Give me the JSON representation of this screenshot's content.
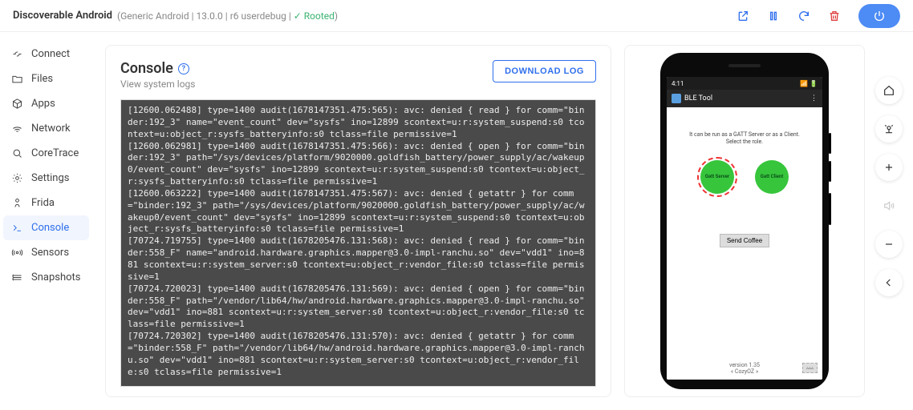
{
  "header": {
    "device_name": "Discoverable Android",
    "meta_os": "Generic Android",
    "meta_ver": "13.0.0",
    "meta_build": "r6 userdebug",
    "rooted_label": "Rooted"
  },
  "sidebar": {
    "items": [
      {
        "label": "Connect"
      },
      {
        "label": "Files"
      },
      {
        "label": "Apps"
      },
      {
        "label": "Network"
      },
      {
        "label": "CoreTrace"
      },
      {
        "label": "Settings"
      },
      {
        "label": "Frida"
      },
      {
        "label": "Console"
      },
      {
        "label": "Sensors"
      },
      {
        "label": "Snapshots"
      }
    ]
  },
  "console": {
    "title": "Console",
    "subtitle": "View system logs",
    "download_label": "DOWNLOAD LOG",
    "log_text": "[12600.062488] type=1400 audit(1678147351.475:565): avc: denied { read } for comm=\"binder:192_3\" name=\"event_count\" dev=\"sysfs\" ino=12899 scontext=u:r:system_suspend:s0 tcontext=u:object_r:sysfs_batteryinfo:s0 tclass=file permissive=1\n[12600.062981] type=1400 audit(1678147351.475:566): avc: denied { open } for comm=\"binder:192_3\" path=\"/sys/devices/platform/9020000.goldfish_battery/power_supply/ac/wakeup0/event_count\" dev=\"sysfs\" ino=12899 scontext=u:r:system_suspend:s0 tcontext=u:object_r:sysfs_batteryinfo:s0 tclass=file permissive=1\n[12600.063222] type=1400 audit(1678147351.475:567): avc: denied { getattr } for comm=\"binder:192_3\" path=\"/sys/devices/platform/9020000.goldfish_battery/power_supply/ac/wakeup0/event_count\" dev=\"sysfs\" ino=12899 scontext=u:r:system_suspend:s0 tcontext=u:object_r:sysfs_batteryinfo:s0 tclass=file permissive=1\n[70724.719755] type=1400 audit(1678205476.131:568): avc: denied { read } for comm=\"binder:558_F\" name=\"android.hardware.graphics.mapper@3.0-impl-ranchu.so\" dev=\"vdd1\" ino=881 scontext=u:r:system_server:s0 tcontext=u:object_r:vendor_file:s0 tclass=file permissive=1\n[70724.720023] type=1400 audit(1678205476.131:569): avc: denied { open } for comm=\"binder:558_F\" path=\"/vendor/lib64/hw/android.hardware.graphics.mapper@3.0-impl-ranchu.so\" dev=\"vdd1\" ino=881 scontext=u:r:system_server:s0 tcontext=u:object_r:vendor_file:s0 tclass=file permissive=1\n[70724.720302] type=1400 audit(1678205476.131:570): avc: denied { getattr } for comm=\"binder:558_F\" path=\"/vendor/lib64/hw/android.hardware.graphics.mapper@3.0-impl-ranchu.so\" dev=\"vdd1\" ino=881 scontext=u:r:system_server:s0 tcontext=u:object_r:vendor_file:s0 tclass=file permissive=1"
  },
  "phone": {
    "time": "4:11",
    "app_title": "BLE Tool",
    "hint_line1": "It can be run as a GATT Server or as a Client.",
    "hint_line2": "Select the role.",
    "gatt_server": "Gatt\nServer",
    "gatt_client": "Gatt\nClient",
    "send_btn": "Send Coffee",
    "version": "version 1.35",
    "brand": "« CozyOZ »"
  }
}
